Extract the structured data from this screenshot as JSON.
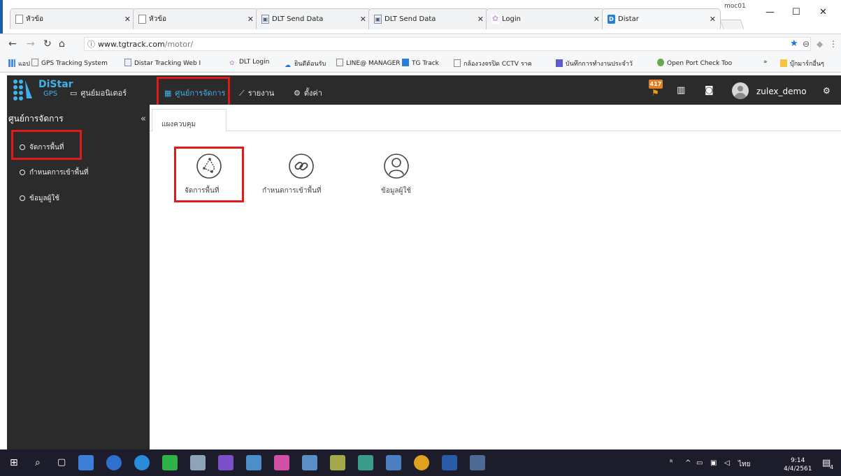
{
  "browser": {
    "tabs": [
      {
        "title": "หัวข้อ",
        "icon": "page-icon"
      },
      {
        "title": "หัวข้อ",
        "icon": "page-icon"
      },
      {
        "title": "DLT Send Data",
        "icon": "image-icon"
      },
      {
        "title": "DLT Send Data",
        "icon": "image-icon"
      },
      {
        "title": "Login",
        "icon": "login-icon"
      },
      {
        "title": "Distar",
        "icon": "distar-icon"
      }
    ],
    "window_user": "moc01",
    "url_host": "www.tgtrack.com",
    "url_path": "/motor/",
    "bookmarks": [
      {
        "label": "แอป",
        "icon": "apps-icon"
      },
      {
        "label": "GPS Tracking System",
        "icon": "page-icon"
      },
      {
        "label": "Distar Tracking Web I",
        "icon": "image-icon"
      },
      {
        "label": "DLT Login",
        "icon": "login-icon"
      },
      {
        "label": "ยินดีต้อนรับ",
        "icon": "cloud-icon"
      },
      {
        "label": "LINE@ MANAGER",
        "icon": "page-icon"
      },
      {
        "label": "TG Track",
        "icon": "distar-icon"
      },
      {
        "label": "กล้องวงจรปิด CCTV ราค",
        "icon": "page-icon"
      },
      {
        "label": "บันทึกการทำงานประจำวั",
        "icon": "list-icon"
      },
      {
        "label": "Open Port Check Too",
        "icon": "globe-icon"
      },
      {
        "label": "»",
        "icon": "more-icon"
      },
      {
        "label": "บุ๊กมาร์กอื่นๆ",
        "icon": "folder-icon"
      }
    ]
  },
  "app": {
    "logo_name": "DiStar",
    "logo_sub": "GPS",
    "menu": [
      {
        "label": "ศูนย์มอนิเตอร์",
        "icon": "monitor-icon",
        "active": false
      },
      {
        "label": "ศูนย์การจัดการ",
        "icon": "grid-icon",
        "active": true
      },
      {
        "label": "รายงาน",
        "icon": "chart-icon",
        "active": false
      },
      {
        "label": "ตั้งค่า",
        "icon": "gear-icon",
        "active": false
      }
    ],
    "notification_count": "417",
    "username": "zulex_demo"
  },
  "sidebar": {
    "title": "ศูนย์การจัดการ",
    "collapse": "«",
    "items": [
      {
        "label": "จัดการพื้นที่"
      },
      {
        "label": "กำหนดการเข้าพื้นที่"
      },
      {
        "label": "ข้อมูลผู้ใช้"
      }
    ]
  },
  "main": {
    "tab_label": "แผงควบคุม",
    "tiles": [
      {
        "label": "จัดการพื้นที่",
        "icon": "area-icon"
      },
      {
        "label": "กำหนดการเข้าพื้นที่",
        "icon": "link-icon"
      },
      {
        "label": "ข้อมูลผู้ใช้",
        "icon": "user-icon"
      }
    ]
  },
  "taskbar": {
    "time": "9:14",
    "date": "4/4/2561",
    "lang": "ไทย",
    "notif_count": "4"
  },
  "colors": {
    "header_bg": "#2b2b2b",
    "accent": "#3fb2ee",
    "highlight": "#e01a1a",
    "taskbar": "#1c1c2a"
  }
}
